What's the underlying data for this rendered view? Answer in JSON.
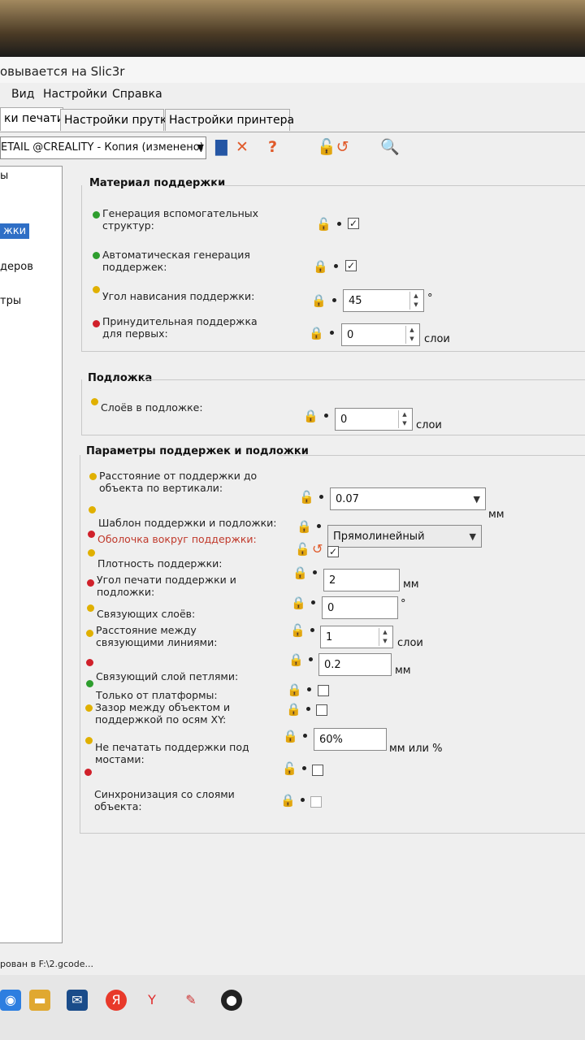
{
  "window": {
    "title": "овывается на Slic3r"
  },
  "menu": {
    "items": [
      "Вид",
      "Настройки",
      "Справка"
    ]
  },
  "tabs": {
    "print": "ки печати",
    "filament": "Настройки прутка",
    "printer": "Настройки принтера"
  },
  "toolbar": {
    "preset": "ETAIL @CREALITY - Копия (изменено)"
  },
  "left_panel": {
    "items": [
      "ы",
      "жки",
      "деров",
      "тры"
    ]
  },
  "support_material": {
    "title": "Материал поддержки",
    "generate_label": "Генерация вспомогательных структур:",
    "generate_checked": "✓",
    "auto_label": "Автоматическая генерация поддержек:",
    "auto_checked": "✓",
    "overhang_label": "Угол нависания поддержки:",
    "overhang_value": "45",
    "overhang_unit": "°",
    "enforce_label": "Принудительная поддержка для первых:",
    "enforce_value": "0",
    "enforce_unit": "слои"
  },
  "raft": {
    "title": "Подложка",
    "layers_label": "Слоёв в подложке:",
    "layers_value": "0",
    "layers_unit": "слои"
  },
  "options": {
    "title": "Параметры поддержек и подложки",
    "contact_z_label": "Расстояние от поддержки до объекта по вертикали:",
    "contact_z_value": "0.07",
    "contact_z_unit": "мм",
    "pattern_label": "Шаблон поддержки и подложки:",
    "pattern_value": "Прямолинейный",
    "shell_label": "Оболочка вокруг поддержки:",
    "shell_checked": "✓",
    "density_label": "Плотность поддержки:",
    "density_value": "2",
    "density_unit": "мм",
    "angle_label": "Угол печати поддержки и подложки:",
    "angle_value": "0",
    "angle_unit": "°",
    "interface_layers_label": "Связующих слоёв:",
    "interface_layers_value": "1",
    "interface_layers_unit": "слои",
    "interface_spacing_label": "Расстояние между связующими линиями:",
    "interface_spacing_value": "0.2",
    "interface_spacing_unit": "мм",
    "interface_loops_label": "Связующий слой петлями:",
    "buildplate_only_label": "Только от платформы:",
    "xy_gap_label": "Зазор между объектом и поддержкой по осям XY:",
    "xy_gap_value": "60%",
    "xy_gap_unit": "мм или %",
    "no_bridges_label": "Не печатать поддержки под мостами:",
    "sync_label": "Синхронизация со слоями объекта:"
  },
  "status": {
    "text": "рован в F:\\2.gcode..."
  }
}
